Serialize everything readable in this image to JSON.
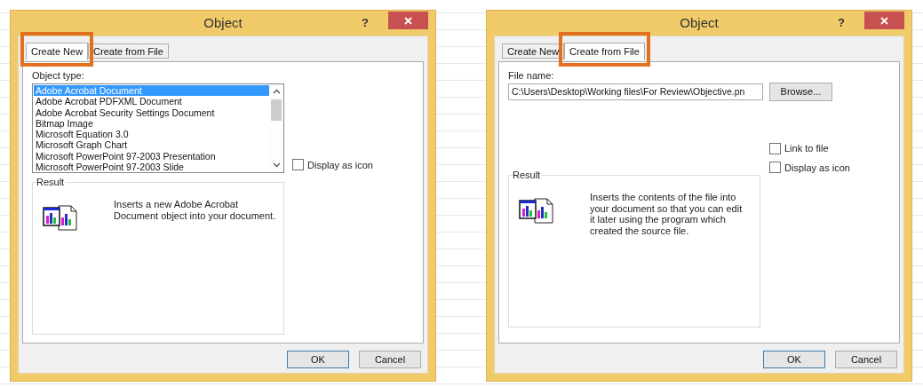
{
  "dialogs": [
    {
      "title": "Object",
      "help": "?",
      "tabs": [
        {
          "label": "Create New",
          "selected": true,
          "highlighted": true
        },
        {
          "label": "Create from File",
          "selected": false,
          "highlighted": false
        }
      ],
      "panel": {
        "kind": "create_new",
        "list_label": "Object type:",
        "items": [
          {
            "label": "Adobe Acrobat Document",
            "selected": true
          },
          {
            "label": "Adobe Acrobat PDFXML Document",
            "selected": false
          },
          {
            "label": "Adobe Acrobat Security Settings Document",
            "selected": false
          },
          {
            "label": "Bitmap Image",
            "selected": false
          },
          {
            "label": "Microsoft Equation 3.0",
            "selected": false
          },
          {
            "label": "Microsoft Graph Chart",
            "selected": false
          },
          {
            "label": "Microsoft PowerPoint 97-2003 Presentation",
            "selected": false
          },
          {
            "label": "Microsoft PowerPoint 97-2003 Slide",
            "selected": false
          }
        ],
        "checkboxes": [
          {
            "label": "Display as icon",
            "checked": false
          }
        ],
        "result": {
          "title": "Result",
          "text": "Inserts a new Adobe Acrobat Document object into your document."
        }
      },
      "buttons": [
        {
          "label": "OK",
          "default": true
        },
        {
          "label": "Cancel",
          "default": false
        }
      ]
    },
    {
      "title": "Object",
      "help": "?",
      "tabs": [
        {
          "label": "Create New",
          "selected": false,
          "highlighted": false
        },
        {
          "label": "Create from File",
          "selected": true,
          "highlighted": true
        }
      ],
      "panel": {
        "kind": "create_from_file",
        "field_label": "File name:",
        "field_value": "C:\\Users\\Desktop\\Working files\\For Review\\Objective.pn",
        "browse_button": "Browse...",
        "checkboxes": [
          {
            "label": "Link to file",
            "checked": false
          },
          {
            "label": "Display as icon",
            "checked": false
          }
        ],
        "result": {
          "title": "Result",
          "text": "Inserts the contents of the file into your document so that you can edit it later using the program which created the source file."
        }
      },
      "buttons": [
        {
          "label": "OK",
          "default": true
        },
        {
          "label": "Cancel",
          "default": false
        }
      ]
    }
  ]
}
